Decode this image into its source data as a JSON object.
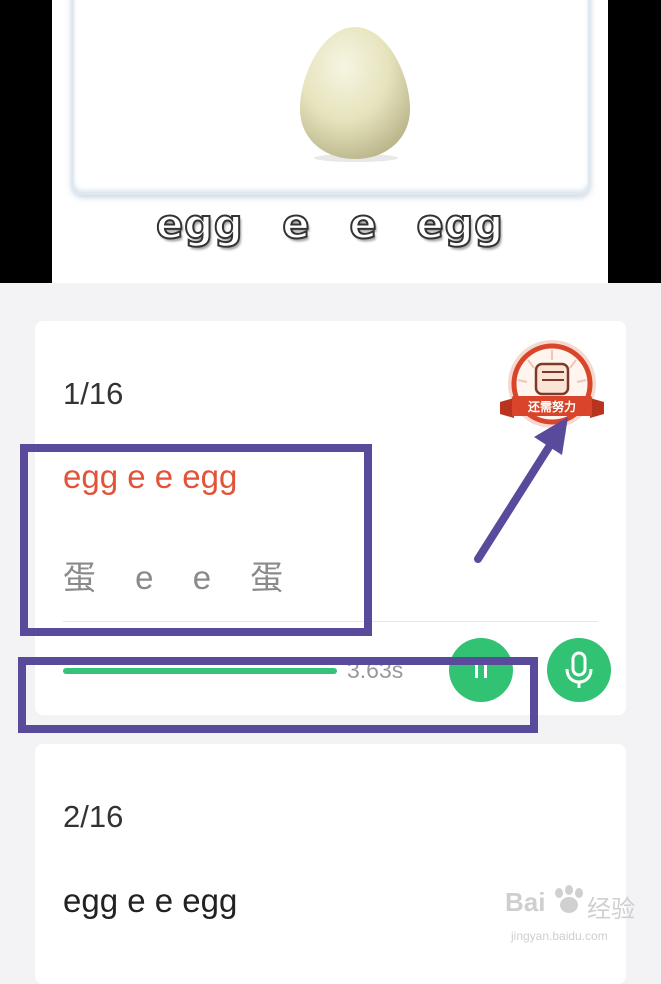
{
  "media": {
    "caption": "egg  e  e  egg"
  },
  "cards": [
    {
      "counter": "1/16",
      "sentence_en": "egg e e egg",
      "sentence_en_color": "#e2543a",
      "sentence_zh": "蛋  e  e  蛋",
      "duration": "3.63s",
      "badge_text": "还需努力"
    },
    {
      "counter": "2/16",
      "sentence_en": "egg e e egg",
      "sentence_en_color": "#222222"
    }
  ],
  "watermark": {
    "brand": "Bai",
    "brand2": "经验",
    "url": "jingyan.baidu.com"
  },
  "colors": {
    "accent_green": "#32c273",
    "annotation_purple": "#5a4a9c",
    "badge_red": "#d9452b"
  }
}
